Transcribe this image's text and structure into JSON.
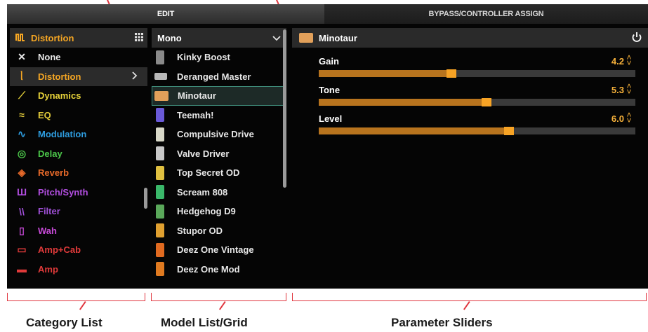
{
  "tabs": {
    "edit": "EDIT",
    "bypass": "BYPASS/CONTROLLER ASSIGN"
  },
  "category": {
    "header_label": "Distortion",
    "header_icon": "distortion-wave-icon",
    "grid_icon": "grid-icon",
    "items": [
      {
        "label": "None",
        "color": "#e8e8e8",
        "glyph": "✕"
      },
      {
        "label": "Distortion",
        "color": "#f5a623",
        "glyph": "ᥣ"
      },
      {
        "label": "Dynamics",
        "color": "#e8d43a",
        "glyph": "⟋"
      },
      {
        "label": "EQ",
        "color": "#e0c93a",
        "glyph": "≈"
      },
      {
        "label": "Modulation",
        "color": "#2e9de0",
        "glyph": "∿"
      },
      {
        "label": "Delay",
        "color": "#4cc84a",
        "glyph": "◎"
      },
      {
        "label": "Reverb",
        "color": "#e86a2a",
        "glyph": "◈"
      },
      {
        "label": "Pitch/Synth",
        "color": "#b24ee0",
        "glyph": "Ш"
      },
      {
        "label": "Filter",
        "color": "#a050d8",
        "glyph": "\\\\"
      },
      {
        "label": "Wah",
        "color": "#c84ad8",
        "glyph": "▯"
      },
      {
        "label": "Amp+Cab",
        "color": "#e03a3a",
        "glyph": "▭"
      },
      {
        "label": "Amp",
        "color": "#e03a3a",
        "glyph": "▬"
      }
    ],
    "selected_index": 1
  },
  "model": {
    "header_label": "Mono",
    "items": [
      {
        "label": "Kinky Boost",
        "color": "#8a8a8a"
      },
      {
        "label": "Deranged Master",
        "color": "#b8b8b8"
      },
      {
        "label": "Minotaur",
        "color": "#e2a05a"
      },
      {
        "label": "Teemah!",
        "color": "#6a5ad8"
      },
      {
        "label": "Compulsive Drive",
        "color": "#d8d8c8"
      },
      {
        "label": "Valve Driver",
        "color": "#c8c8c8"
      },
      {
        "label": "Top Secret OD",
        "color": "#e0c040"
      },
      {
        "label": "Scream 808",
        "color": "#3ab86a"
      },
      {
        "label": "Hedgehog D9",
        "color": "#5aa85a"
      },
      {
        "label": "Stupor OD",
        "color": "#e0a030"
      },
      {
        "label": "Deez One Vintage",
        "color": "#e06a20"
      },
      {
        "label": "Deez One Mod",
        "color": "#e07a20"
      }
    ],
    "selected_index": 2
  },
  "params": {
    "header_label": "Minotaur",
    "sliders": [
      {
        "label": "Gain",
        "value": "4.2",
        "fraction": 0.42
      },
      {
        "label": "Tone",
        "value": "5.3",
        "fraction": 0.53
      },
      {
        "label": "Level",
        "value": "6.0",
        "fraction": 0.6
      }
    ]
  },
  "callouts": {
    "category_list": "Category List",
    "model_list": "Model List/Grid",
    "parameter_sliders": "Parameter Sliders"
  },
  "colors": {
    "accent": "#f5a623",
    "slider_fill": "#b8741e",
    "selection_border": "#3e8a78",
    "annotation": "#e0363f"
  }
}
